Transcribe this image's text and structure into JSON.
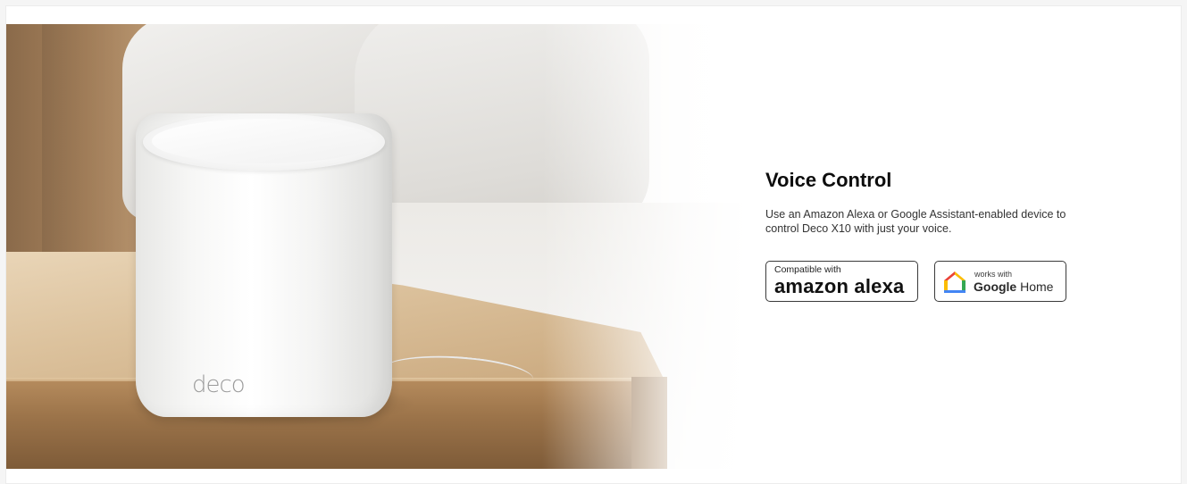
{
  "section": {
    "title": "Voice Control",
    "description": "Use an Amazon Alexa or Google Assistant-enabled device to control Deco X10 with just your voice."
  },
  "hero": {
    "device_logo": "deco"
  },
  "badges": {
    "alexa": {
      "top_text": "Compatible with",
      "brand_text": "amazon alexa"
    },
    "google": {
      "top_text": "works with",
      "brand_bold": "Google",
      "brand_rest": " Home",
      "icon": "google-home-icon"
    }
  },
  "colors": {
    "text_primary": "#0d0d0d",
    "google_red": "#ea4335",
    "google_yellow": "#fbbc04",
    "google_green": "#34a853",
    "google_blue": "#4285f4"
  }
}
